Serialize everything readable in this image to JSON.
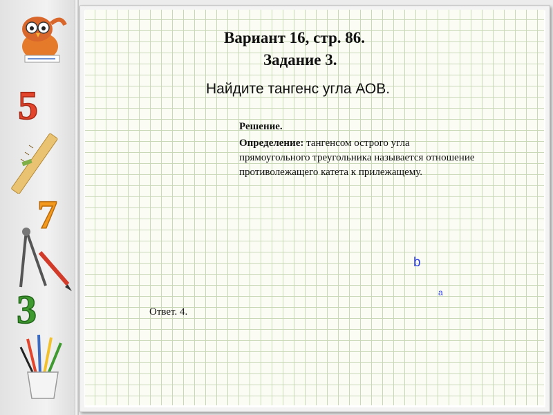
{
  "slide": {
    "title_line1": "Вариант 16, стр. 86.",
    "title_line2": "Задание 3.",
    "task": "Найдите тангенс угла АОВ.",
    "solution_label": "Решение.",
    "definition_label": "Определение:",
    "definition_line1": " тангенсом острого угла",
    "definition_line2": "прямоугольного треугольника называется отношение",
    "definition_line3": "противолежащего катета к прилежащему.",
    "answer": "Ответ. 4.",
    "label_b": "b",
    "label_a": "a"
  },
  "sidebar": {
    "icons": [
      "owl-mascot-icon",
      "digit-5-icon",
      "ruler-icon",
      "digit-7-icon",
      "compass-icon",
      "digit-3-icon",
      "pencil-cup-icon"
    ]
  },
  "colors": {
    "grid_line": "#c9d8b6",
    "grid_bg": "#fbfcf3",
    "label_blue": "#2b3ce8",
    "digit_red": "#e2452b",
    "digit_orange": "#f39a1e",
    "digit_green": "#3f9a2f"
  }
}
